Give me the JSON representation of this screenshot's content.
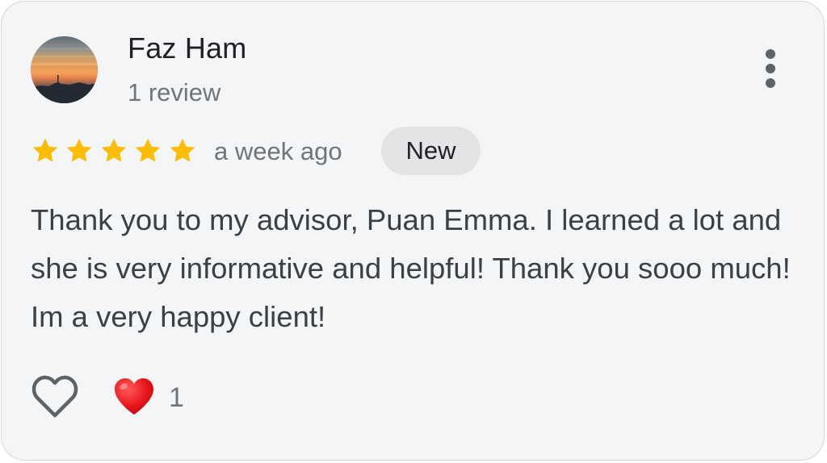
{
  "review": {
    "author": {
      "name": "Faz Ham",
      "meta": "1 review",
      "avatar_icon": "sunset-photo-avatar"
    },
    "rating": 5,
    "rating_max": 5,
    "star_color": "#fbbc04",
    "time_ago": "a week ago",
    "badge": "New",
    "text": "Thank you to my advisor, Puan Emma. I learned a lot and she is very informative and helpful! Thank you sooo much! Im a very happy client!",
    "more_icon": "more-vert-icon",
    "like_icon": "heart-outline-icon",
    "reaction": {
      "icon": "red-heart-emoji",
      "count": "1"
    }
  }
}
